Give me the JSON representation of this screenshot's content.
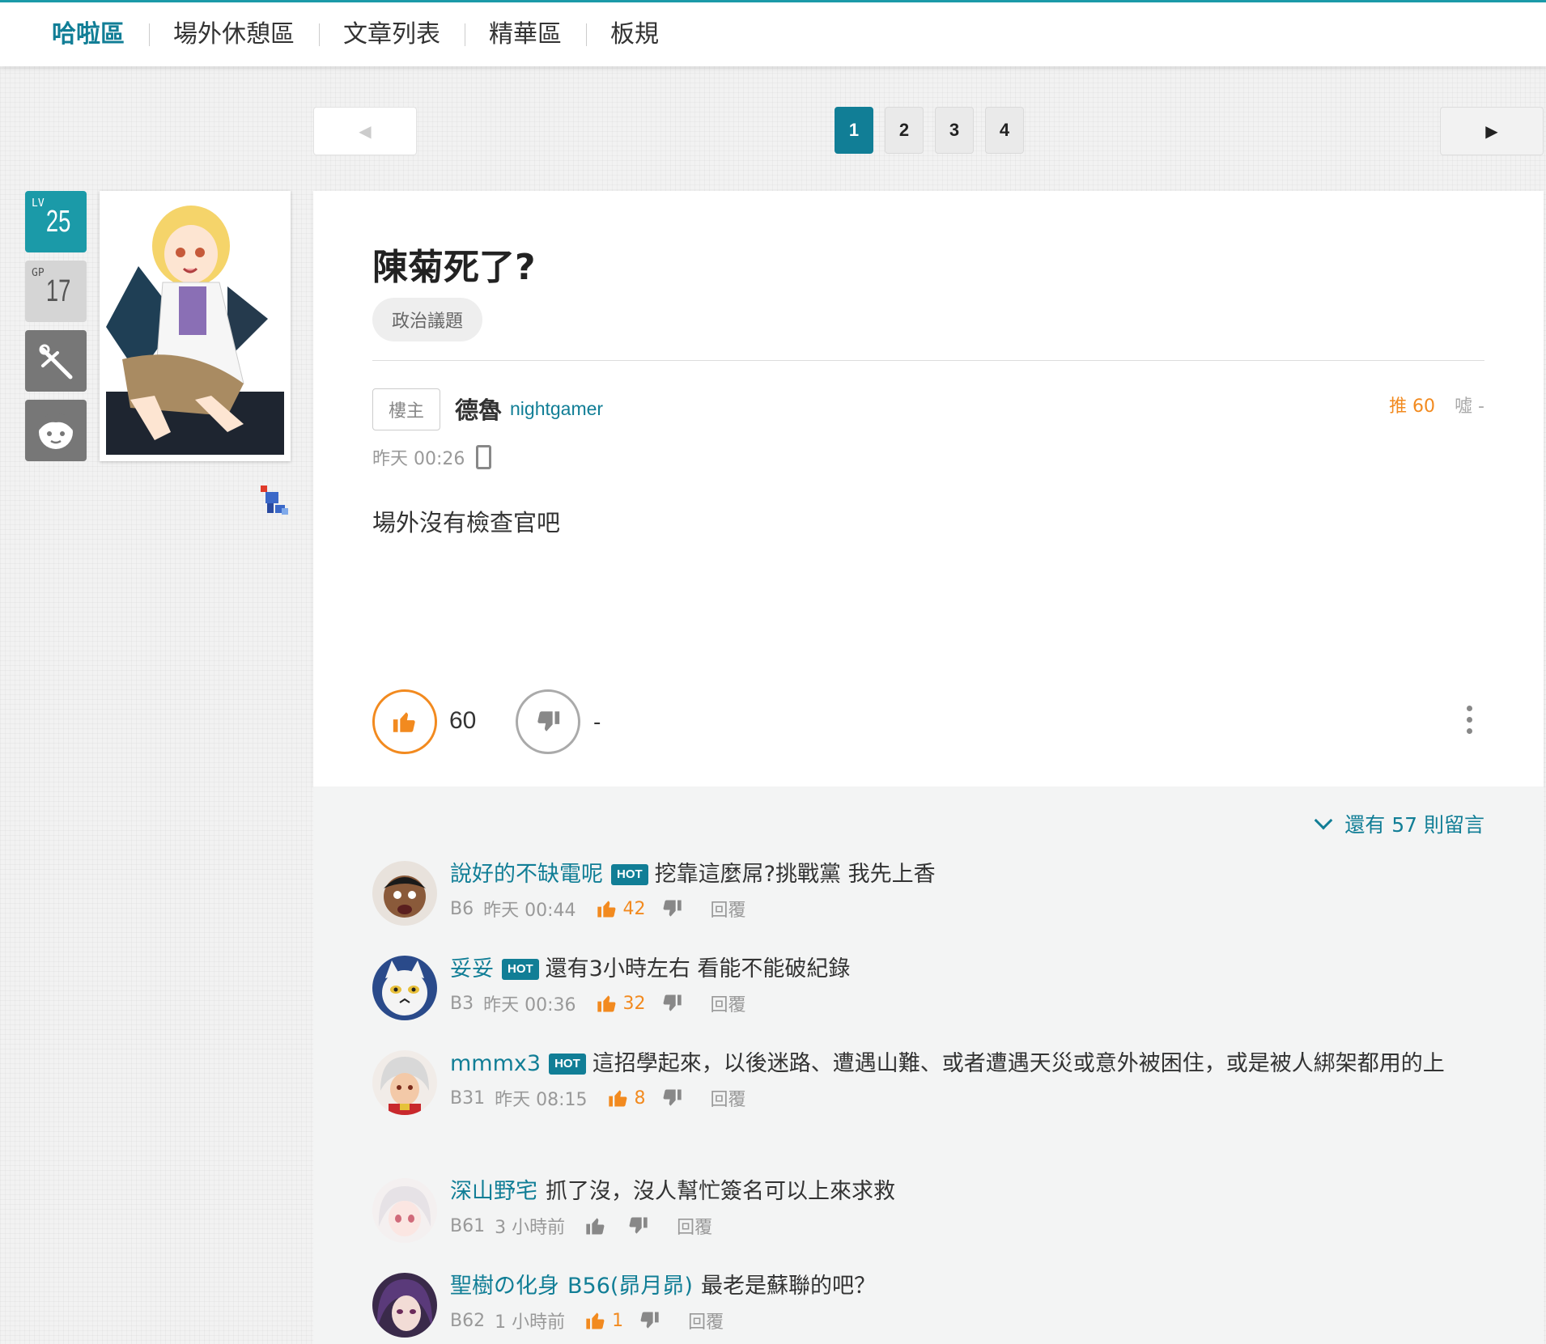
{
  "nav": {
    "items": [
      "哈啦區",
      "場外休憩區",
      "文章列表",
      "精華區",
      "板規"
    ]
  },
  "pager": {
    "prev": "◀",
    "next": "▶",
    "pages": [
      "1",
      "2",
      "3",
      "4"
    ]
  },
  "user": {
    "lv_label": "LV",
    "lv_value": "25",
    "gp_label": "GP",
    "gp_value": "17"
  },
  "post": {
    "title": "陳菊死了?",
    "tag": "政治議題",
    "floor": "樓主",
    "author_name": "德魯",
    "author_id": "nightgamer",
    "push_label": "推 60",
    "boo_label": "噓 -",
    "time": "昨天 00:26",
    "body": "場外沒有檢查官吧",
    "up_count": "60",
    "down_count": "-"
  },
  "comments": {
    "more_label": "還有 57 則留言",
    "hot_label": "HOT",
    "reply_label": "回覆",
    "items": [
      {
        "name": "說好的不缺電呢",
        "hot": true,
        "text": "挖靠這麼屌?挑戰黨 我先上香",
        "floor": "B6",
        "time": "昨天 00:44",
        "gp": "42"
      },
      {
        "name": "妥妥",
        "hot": true,
        "text": "還有3小時左右 看能不能破紀錄",
        "floor": "B3",
        "time": "昨天 00:36",
        "gp": "32"
      },
      {
        "name": "mmmx3",
        "hot": true,
        "text": "這招學起來，以後迷路、遭遇山難、或者遭遇天災或意外被困住，或是被人綁架都用的上",
        "floor": "B31",
        "time": "昨天 08:15",
        "gp": "8"
      },
      {
        "name": "深山野宅",
        "hot": false,
        "text": "抓了沒，沒人幫忙簽名可以上來求救",
        "floor": "B61",
        "time": "3 小時前",
        "gp": ""
      },
      {
        "name": "聖樹の化身",
        "hot": false,
        "ref": "B56(昴月昴)",
        "text": "最老是蘇聯的吧？",
        "floor": "B62",
        "time": "1 小時前",
        "gp": "1"
      }
    ]
  }
}
